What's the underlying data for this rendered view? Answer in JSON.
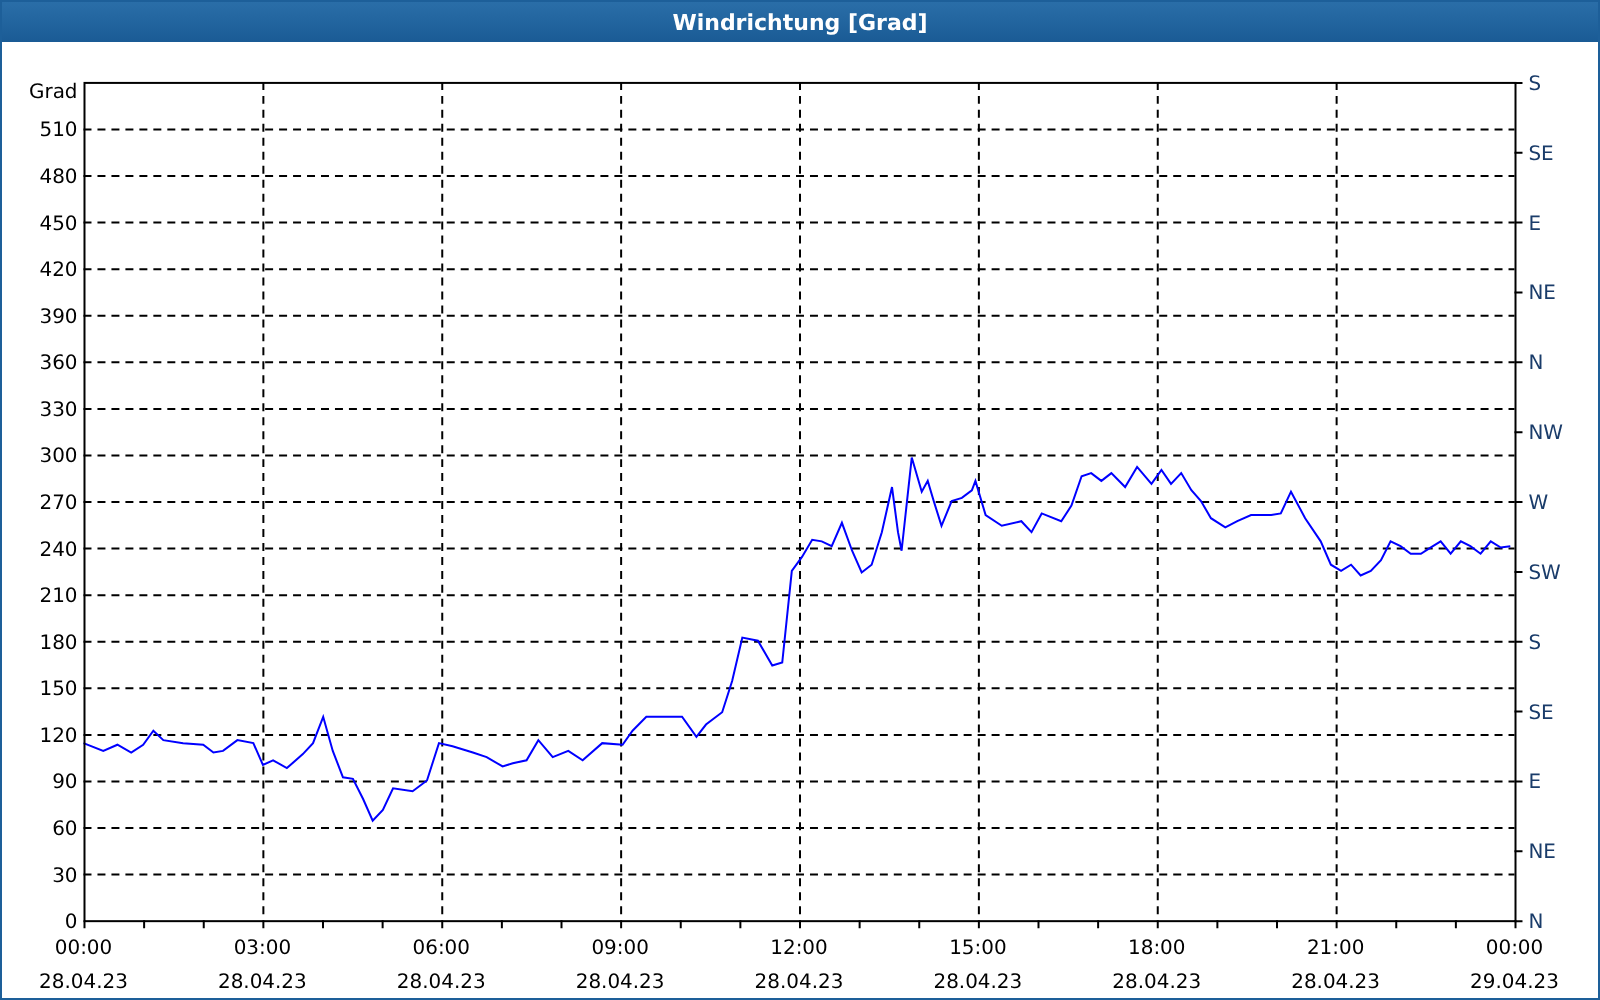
{
  "window": {
    "title": "Windrichtung [Grad]"
  },
  "chart": {
    "chart_data": {
      "type": "line",
      "grid": true,
      "ylabel": "Grad",
      "xlim": [
        0,
        24
      ],
      "ylim": [
        0,
        540
      ],
      "xticks": [
        {
          "value": 0,
          "label": "00:00"
        },
        {
          "value": 3,
          "label": "03:00"
        },
        {
          "value": 6,
          "label": "06:00"
        },
        {
          "value": 9,
          "label": "09:00"
        },
        {
          "value": 12,
          "label": "12:00"
        },
        {
          "value": 15,
          "label": "15:00"
        },
        {
          "value": 18,
          "label": "18:00"
        },
        {
          "value": 21,
          "label": "21:00"
        },
        {
          "value": 24,
          "label": "00:00"
        }
      ],
      "yticks": [
        0,
        30,
        60,
        90,
        120,
        150,
        180,
        210,
        240,
        270,
        300,
        330,
        360,
        390,
        420,
        450,
        480,
        510
      ],
      "x": [
        0,
        0.33,
        0.57,
        0.8,
        1.0,
        1.17,
        1.34,
        1.67,
        2.01,
        2.18,
        2.34,
        2.58,
        2.85,
        3.01,
        3.18,
        3.41,
        3.68,
        3.85,
        4.02,
        4.18,
        4.35,
        4.52,
        4.69,
        4.85,
        5.02,
        5.19,
        5.52,
        5.76,
        5.96,
        6.19,
        6.53,
        6.76,
        7.03,
        7.2,
        7.43,
        7.63,
        7.87,
        8.13,
        8.37,
        8.7,
        9.04,
        9.21,
        9.44,
        9.71,
        10.04,
        10.28,
        10.44,
        10.71,
        10.88,
        11.05,
        11.31,
        11.55,
        11.72,
        11.88,
        12.05,
        12.22,
        12.38,
        12.55,
        12.72,
        12.89,
        13.05,
        13.22,
        13.39,
        13.56,
        13.66,
        13.72,
        13.89,
        14.06,
        14.16,
        14.26,
        14.39,
        14.56,
        14.73,
        14.9,
        14.96,
        15.13,
        15.4,
        15.73,
        15.9,
        16.07,
        16.4,
        16.57,
        16.74,
        16.9,
        17.07,
        17.24,
        17.47,
        17.67,
        17.91,
        18.08,
        18.24,
        18.41,
        18.58,
        18.74,
        18.91,
        19.15,
        19.35,
        19.58,
        19.92,
        20.08,
        20.25,
        20.49,
        20.75,
        20.92,
        21.09,
        21.26,
        21.42,
        21.59,
        21.76,
        21.92,
        22.09,
        22.26,
        22.43,
        22.59,
        22.76,
        22.93,
        23.1,
        23.26,
        23.43,
        23.6,
        23.77,
        23.93
      ],
      "series": [
        {
          "color": "#0000ff",
          "values": [
            114,
            109,
            113,
            108,
            113,
            122,
            116,
            114,
            113,
            108,
            109,
            116,
            114,
            100,
            103,
            98,
            107,
            114,
            131,
            109,
            92,
            91,
            78,
            64,
            71,
            85,
            83,
            90,
            114,
            112,
            108,
            105,
            99,
            101,
            103,
            116,
            105,
            109,
            103,
            114,
            113,
            122,
            131,
            131,
            131,
            118,
            126,
            134,
            154,
            182,
            180,
            164,
            166,
            225,
            234,
            245,
            244,
            241,
            256,
            238,
            224,
            229,
            250,
            279,
            250,
            238,
            298,
            276,
            283,
            270,
            254,
            270,
            272,
            277,
            283,
            261,
            254,
            257,
            250,
            262,
            257,
            267,
            286,
            288,
            283,
            288,
            279,
            292,
            281,
            290,
            281,
            288,
            277,
            270,
            259,
            253,
            257,
            261,
            261,
            262,
            276,
            259,
            244,
            229,
            225,
            229,
            222,
            225,
            232,
            244,
            241,
            236,
            236,
            240,
            244,
            236,
            244,
            241,
            236,
            244,
            240,
            241
          ]
        }
      ]
    },
    "x_dates": [
      "28.04.23",
      "28.04.23",
      "28.04.23",
      "28.04.23",
      "28.04.23",
      "28.04.23",
      "28.04.23",
      "28.04.23",
      "29.04.23"
    ],
    "compass_scale": [
      "S",
      "SE",
      "E",
      "NE",
      "N",
      "NW",
      "W",
      "SW",
      "S",
      "SE",
      "E",
      "NE",
      "N"
    ]
  }
}
